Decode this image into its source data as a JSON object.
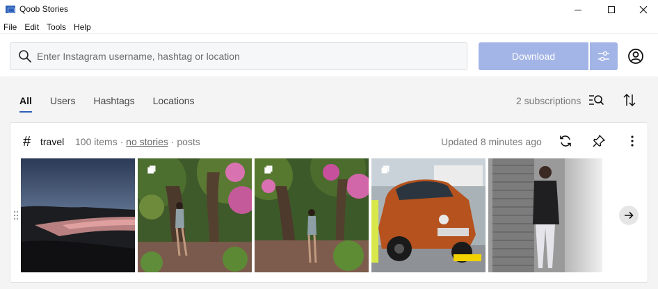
{
  "window": {
    "title": "Qoob Stories",
    "icons": [
      "app-icon",
      "minimize-icon",
      "maximize-icon",
      "close-icon"
    ]
  },
  "menu": [
    "File",
    "Edit",
    "Tools",
    "Help"
  ],
  "search": {
    "placeholder": "Enter Instagram username, hashtag or location",
    "value": ""
  },
  "toolbar": {
    "download_label": "Download",
    "accent_disabled": "#a3b5e6"
  },
  "tabs": [
    {
      "label": "All",
      "active": true
    },
    {
      "label": "Users",
      "active": false
    },
    {
      "label": "Hashtags",
      "active": false
    },
    {
      "label": "Locations",
      "active": false
    }
  ],
  "subscriptions_label": "2 subscriptions",
  "card": {
    "symbol": "#",
    "name": "travel",
    "meta": {
      "items": "100 items",
      "sep1": " · ",
      "stories": "no stories",
      "sep2": " · ",
      "posts": "posts"
    },
    "updated": "Updated 8 minutes ago",
    "thumbnails": [
      {
        "subject": "sunset over lake",
        "multi": false
      },
      {
        "subject": "woman among flowering trees",
        "multi": true
      },
      {
        "subject": "woman standing in garden",
        "multi": true
      },
      {
        "subject": "orange vintage car",
        "multi": true
      },
      {
        "subject": "man in front of shutter",
        "multi": false
      }
    ]
  },
  "colors": {
    "accent": "#2d5fb8",
    "tab_background": "#f4f4f4"
  }
}
